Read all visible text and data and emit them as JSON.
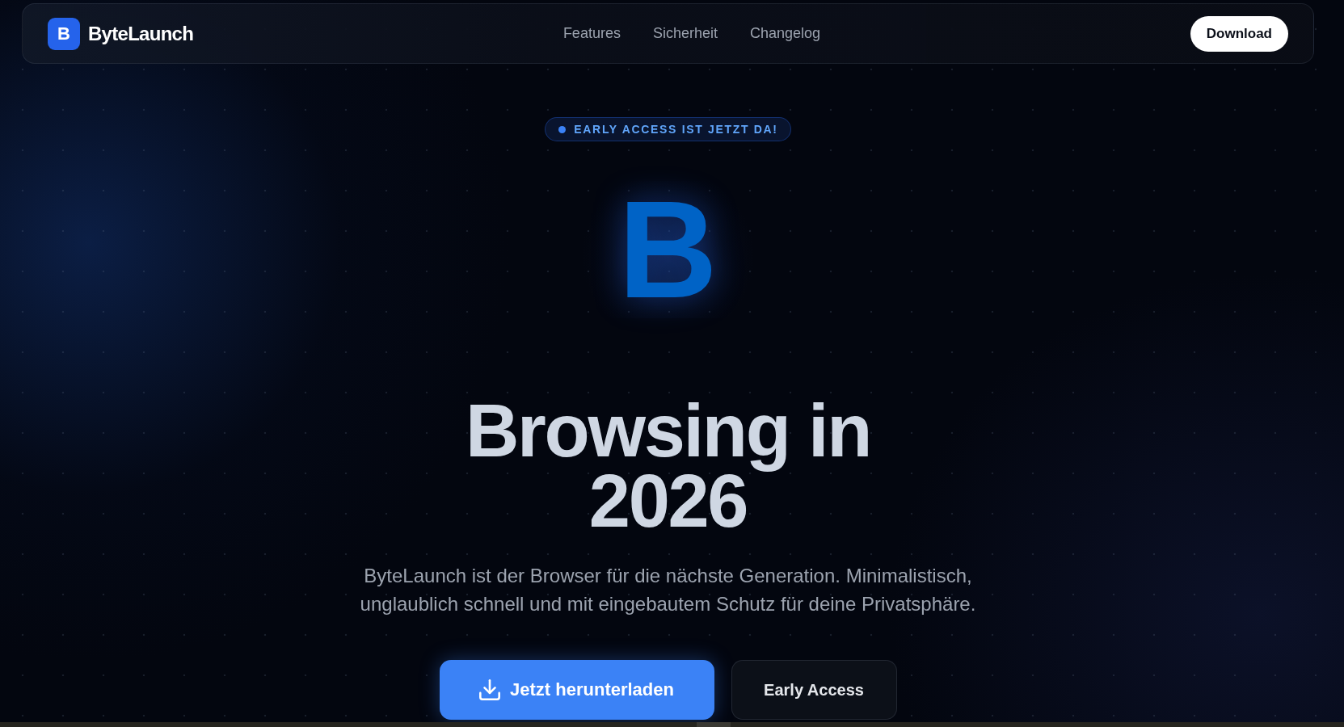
{
  "nav": {
    "logo_mark": "B",
    "brand": "ByteLaunch",
    "links": [
      {
        "label": "Features"
      },
      {
        "label": "Sicherheit"
      },
      {
        "label": "Changelog"
      }
    ],
    "cta": "Download"
  },
  "hero": {
    "badge": "EARLY ACCESS IST JETZT DA!",
    "logo_letter": "B",
    "headline": "Browsing in 2026",
    "description": "ByteLaunch ist der Browser für die nächste Generation. Minimalistisch, unglaublich schnell und mit eingebautem Schutz für deine Privatsphäre.",
    "buttons": [
      {
        "kind": "primary",
        "label": "Jetzt herunterladen"
      },
      {
        "kind": "secondary",
        "label": "Early Access"
      }
    ]
  }
}
